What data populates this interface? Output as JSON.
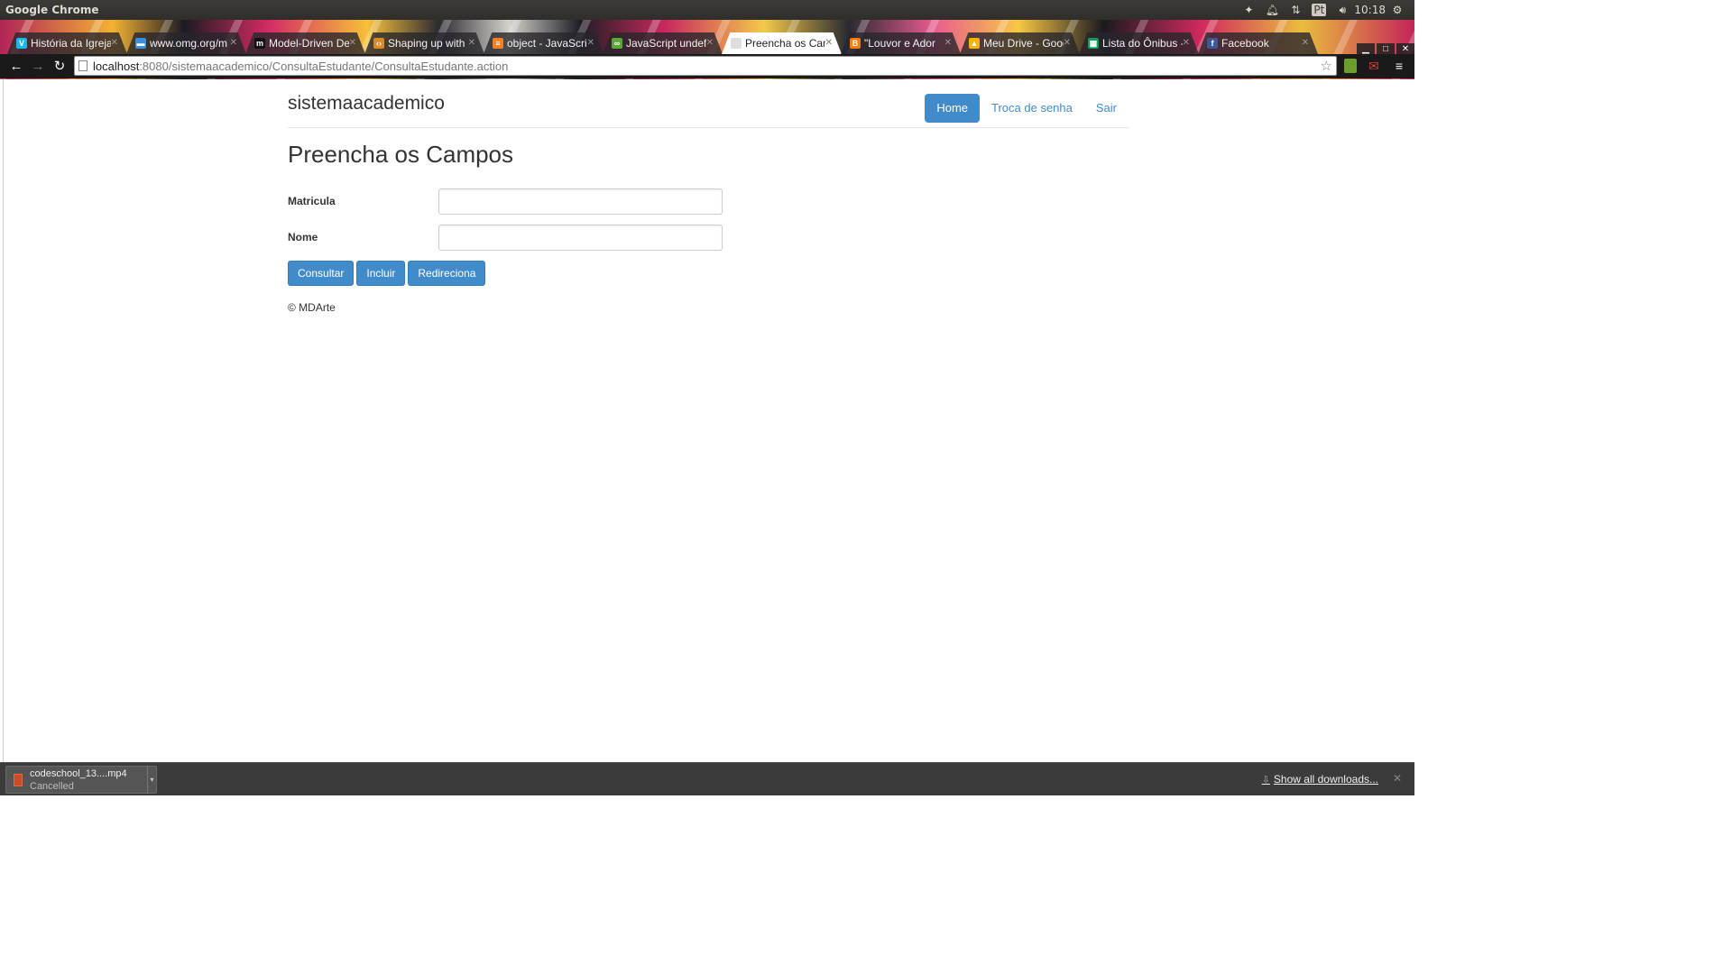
{
  "os": {
    "app_name": "Google Chrome",
    "clock": "10:18",
    "keyboard_layout": "Pt"
  },
  "tabs": [
    {
      "title": "História da Igreja",
      "icon": "vimeo-icon",
      "color": "#1ab7ea",
      "active": false
    },
    {
      "title": "www.omg.org/m",
      "icon": "omg-icon",
      "color": "#3a8fd6",
      "active": false
    },
    {
      "title": "Model-Driven De",
      "icon": "medium-icon",
      "color": "#111111",
      "active": false
    },
    {
      "title": "Shaping up with",
      "icon": "code-icon",
      "color": "#d88a2c",
      "active": false
    },
    {
      "title": "object - JavaScrip",
      "icon": "stackoverflow-icon",
      "color": "#f48024",
      "active": false
    },
    {
      "title": "JavaScript undefi",
      "icon": "jsfiddle-icon",
      "color": "#5ba63a",
      "active": false
    },
    {
      "title": "Preencha os Cam",
      "icon": "page-icon",
      "color": "#dddddd",
      "active": true
    },
    {
      "title": "\"Louvor e Ador",
      "icon": "blogger-icon",
      "color": "#f57d00",
      "active": false
    },
    {
      "title": "Meu Drive - Goog",
      "icon": "drive-icon",
      "color": "#f4b400",
      "active": false
    },
    {
      "title": "Lista do Ônibus -",
      "icon": "sheets-icon",
      "color": "#0f9d58",
      "active": false
    },
    {
      "title": "Facebook",
      "icon": "facebook-icon",
      "color": "#3b5998",
      "active": false
    }
  ],
  "toolbar": {
    "url_host": "localhost",
    "url_rest": ":8080/sistemaacademico/ConsultaEstudante/ConsultaEstudante.action"
  },
  "site": {
    "brand": "sistemaacademico",
    "nav": [
      "Home",
      "Troca de senha",
      "Sair"
    ],
    "active_nav": "Home",
    "accent_color": "#428bca"
  },
  "form": {
    "heading": "Preencha os Campos",
    "fields": [
      {
        "label": "Matricula",
        "value": "",
        "placeholder": ""
      },
      {
        "label": "Nome",
        "value": "",
        "placeholder": ""
      }
    ],
    "buttons": [
      "Consultar",
      "Incluir",
      "Redireciona"
    ]
  },
  "footer": {
    "text": "© MDArte"
  },
  "downloads": {
    "file_name": "codeschool_13....mp4",
    "status": "Cancelled",
    "show_all": "Show all downloads..."
  }
}
